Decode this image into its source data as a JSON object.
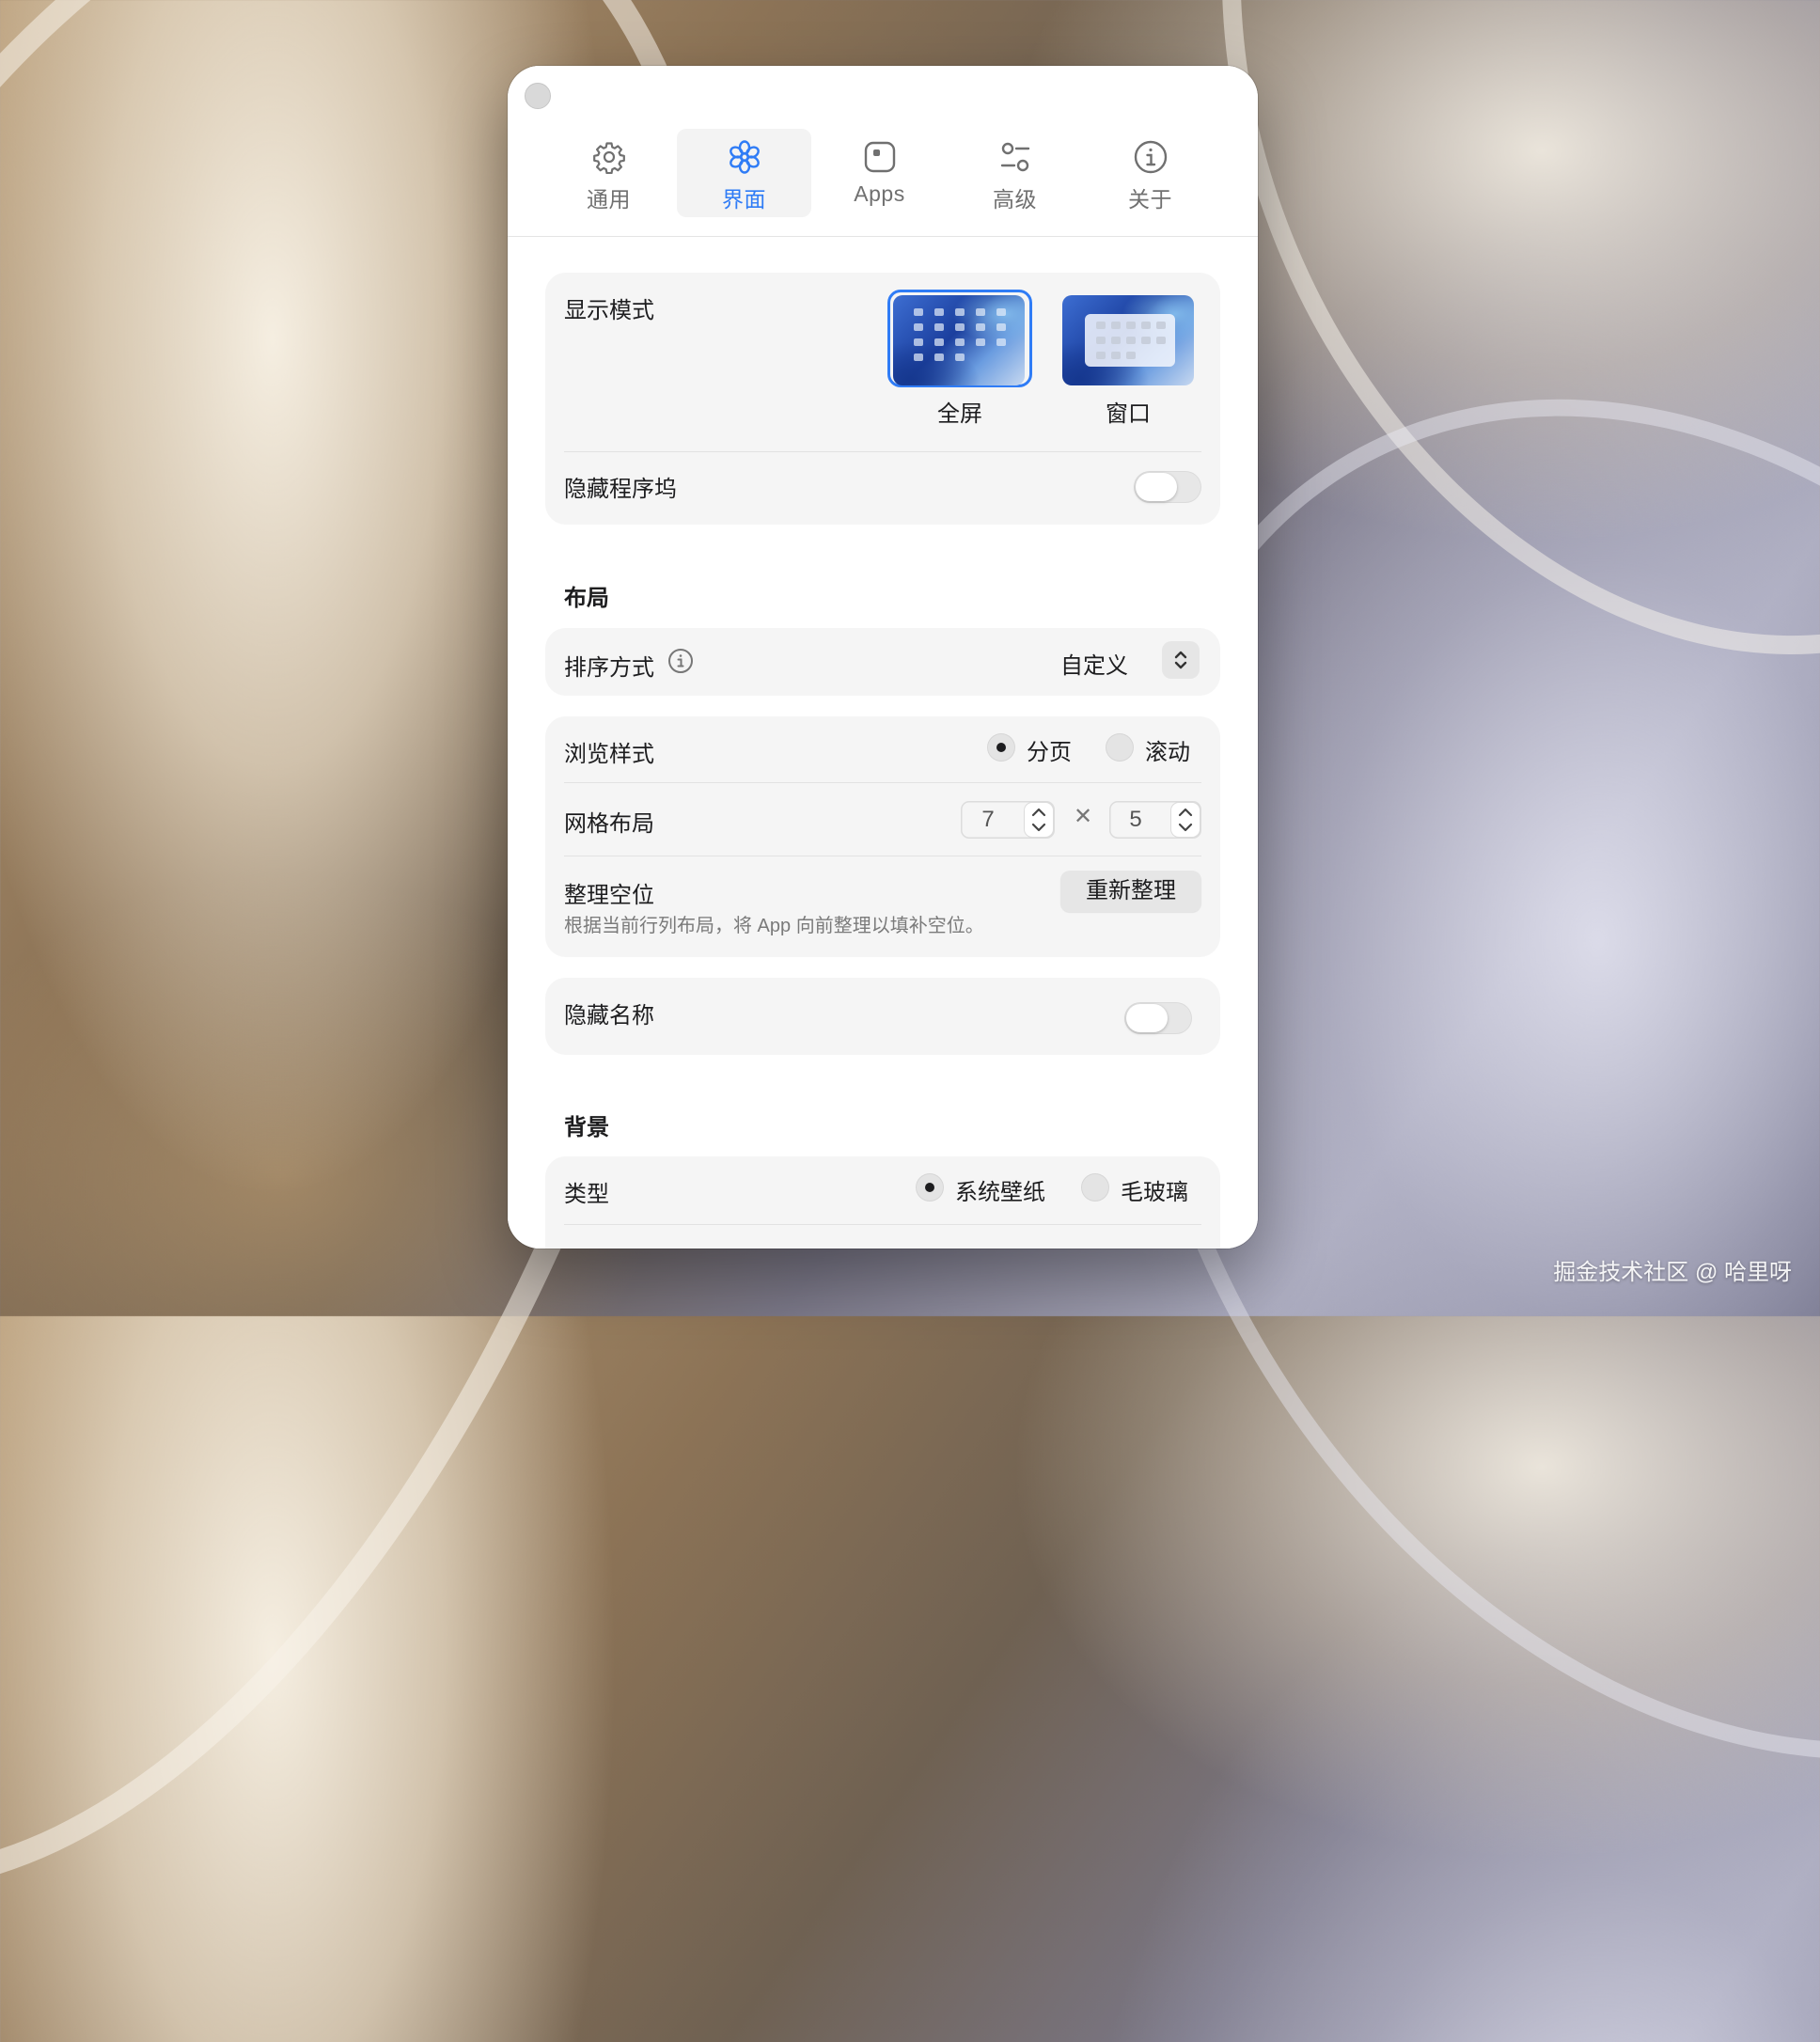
{
  "tabs": [
    {
      "label": "通用",
      "icon": "gear-icon"
    },
    {
      "label": "界面",
      "icon": "flower-icon",
      "active": true
    },
    {
      "label": "Apps",
      "icon": "app-square-icon"
    },
    {
      "label": "高级",
      "icon": "sliders-icon"
    },
    {
      "label": "关于",
      "icon": "info-icon"
    }
  ],
  "display": {
    "title": "显示模式",
    "options": [
      {
        "label": "全屏",
        "selected": true
      },
      {
        "label": "窗口",
        "selected": false
      }
    ],
    "hide_dock_label": "隐藏程序坞",
    "hide_dock_on": false
  },
  "layout": {
    "section_title": "布局",
    "sort_label": "排序方式",
    "sort_value": "自定义",
    "browse_label": "浏览样式",
    "browse_options": [
      {
        "label": "分页",
        "selected": true
      },
      {
        "label": "滚动",
        "selected": false
      }
    ],
    "grid_label": "网格布局",
    "grid_columns": "7",
    "grid_times": "✕",
    "grid_rows": "5",
    "tidy_label": "整理空位",
    "tidy_desc": "根据当前行列布局，将 App 向前整理以填补空位。",
    "tidy_button": "重新整理",
    "hide_names_label": "隐藏名称",
    "hide_names_on": false
  },
  "background": {
    "section_title": "背景",
    "type_label": "类型",
    "type_options": [
      {
        "label": "系统壁纸",
        "selected": true
      },
      {
        "label": "毛玻璃",
        "selected": false
      }
    ]
  },
  "watermark": "掘金技术社区 @ 哈里呀",
  "colors": {
    "accent": "#2f7cf6",
    "card": "#f5f5f5"
  }
}
